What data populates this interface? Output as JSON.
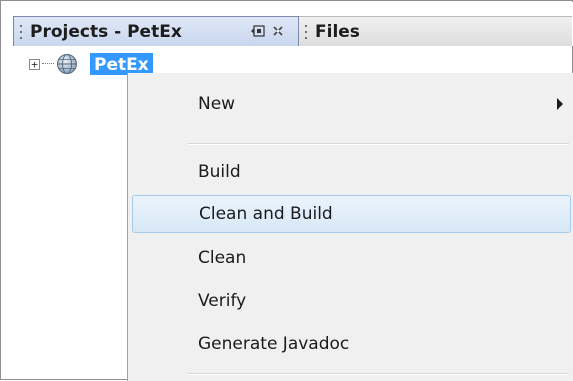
{
  "tabs": [
    {
      "label": "Projects - PetEx",
      "active": true
    },
    {
      "label": "Files",
      "active": false
    }
  ],
  "tab_icons": {
    "minimize": "◫",
    "close": "⌘"
  },
  "tree": {
    "node_label": "PetEx",
    "expander": "+"
  },
  "context_menu": {
    "items": {
      "new": "New",
      "build": "Build",
      "clean_and_build": "Clean and Build",
      "clean": "Clean",
      "verify": "Verify",
      "generate_javadoc": "Generate Javadoc"
    }
  },
  "colors": {
    "selection": "#3399ff",
    "menu_hover": "#d8e8f7",
    "active_tab": "#c9d6ee"
  }
}
